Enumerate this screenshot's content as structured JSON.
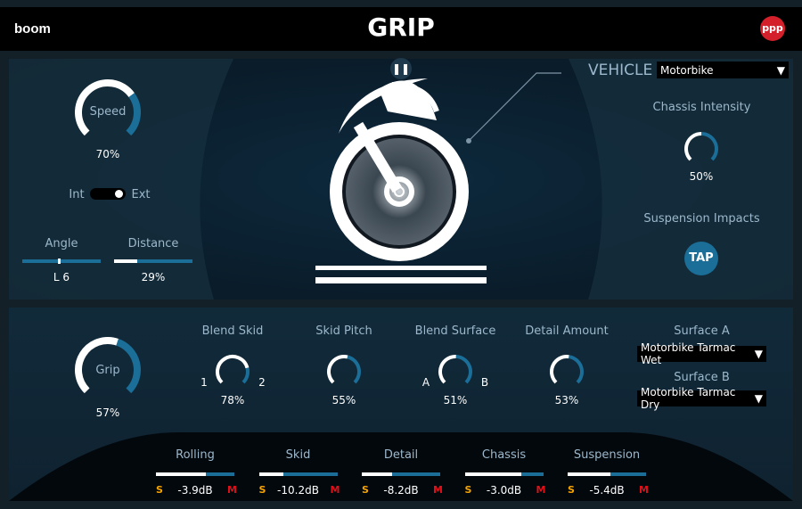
{
  "header": {
    "title": "GRIP",
    "logo": "boom",
    "badge": "ppp"
  },
  "colors": {
    "accent": "#1a6e98",
    "track_fill": "#ffffff",
    "solo": "#f4a300",
    "mute": "#e0101a"
  },
  "left": {
    "speed": {
      "label": "Speed",
      "value": "70%",
      "fraction": 0.7
    },
    "toggle": {
      "left_label": "Int",
      "right_label": "Ext",
      "state": "Ext"
    },
    "angle": {
      "label": "Angle",
      "value": "L 6",
      "fraction": 0.47
    },
    "distance": {
      "label": "Distance",
      "value": "29%",
      "fraction": 0.29
    }
  },
  "center": {
    "pause_icon": "pause-icon"
  },
  "right": {
    "vehicle_label": "VEHICLE",
    "vehicle_value": "Motorbike",
    "chassis": {
      "label": "Chassis Intensity",
      "value": "50%",
      "fraction": 0.5
    },
    "suspension": {
      "label": "Suspension Impacts",
      "button": "TAP"
    }
  },
  "lower": {
    "grip": {
      "label": "Grip",
      "value": "57%",
      "fraction": 0.57
    },
    "blend_skid": {
      "label": "Blend Skid",
      "value": "78%",
      "fraction": 0.78,
      "left": "1",
      "right": "2"
    },
    "skid_pitch": {
      "label": "Skid Pitch",
      "value": "55%",
      "fraction": 0.55
    },
    "blend_surface": {
      "label": "Blend Surface",
      "value": "51%",
      "fraction": 0.51,
      "left": "A",
      "right": "B"
    },
    "detail_amount": {
      "label": "Detail Amount",
      "value": "53%",
      "fraction": 0.53
    },
    "surface_a": {
      "label": "Surface A",
      "value": "Motorbike Tarmac Wet"
    },
    "surface_b": {
      "label": "Surface B",
      "value": "Motorbike Tarmac Dry"
    }
  },
  "mixer": [
    {
      "label": "Rolling",
      "db": "-3.9dB",
      "fraction": 0.64,
      "solo": "S",
      "mute": "M"
    },
    {
      "label": "Skid",
      "db": "-10.2dB",
      "fraction": 0.31,
      "solo": "S",
      "mute": "M"
    },
    {
      "label": "Detail",
      "db": "-8.2dB",
      "fraction": 0.39,
      "solo": "S",
      "mute": "M"
    },
    {
      "label": "Chassis",
      "db": "-3.0dB",
      "fraction": 0.72,
      "solo": "S",
      "mute": "M"
    },
    {
      "label": "Suspension",
      "db": "-5.4dB",
      "fraction": 0.54,
      "solo": "S",
      "mute": "M"
    }
  ]
}
